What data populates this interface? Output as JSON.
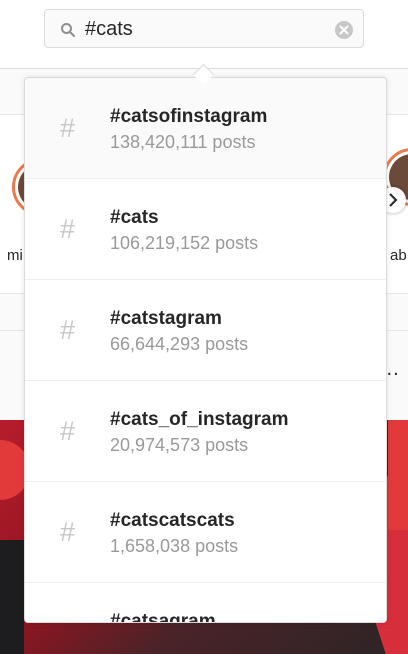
{
  "search": {
    "value": "#cats"
  },
  "background": {
    "story_left_name": "mi",
    "story_right_name": "ab",
    "more_dots": "..."
  },
  "results": [
    {
      "tag": "#catsofinstagram",
      "count": "138,420,111 posts",
      "hash": "#"
    },
    {
      "tag": "#cats",
      "count": "106,219,152 posts",
      "hash": "#"
    },
    {
      "tag": "#catstagram",
      "count": "66,644,293 posts",
      "hash": "#"
    },
    {
      "tag": "#cats_of_instagram",
      "count": "20,974,573 posts",
      "hash": "#"
    },
    {
      "tag": "#catscatscats",
      "count": "1,658,038 posts",
      "hash": "#"
    },
    {
      "tag": "#catsagram",
      "count": "",
      "hash": "#"
    }
  ],
  "colors": {
    "story_ring": "#e97a4d",
    "text_primary": "#262626",
    "text_secondary": "#999999",
    "hash_icon": "#c7c7c7"
  },
  "icons": {
    "search": "search-icon",
    "clear": "clear-icon",
    "hashtag": "hashtag-icon",
    "next": "chevron-right-icon"
  }
}
